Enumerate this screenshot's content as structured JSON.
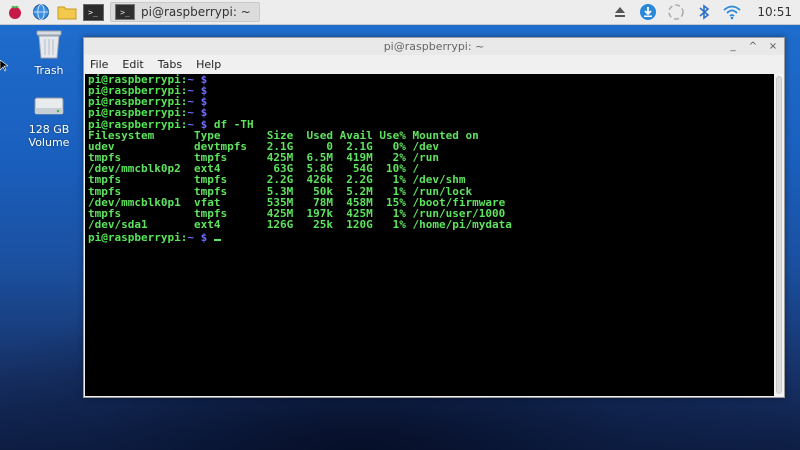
{
  "taskbar": {
    "window_button_label": "pi@raspberrypi: ~",
    "terminal_icon_text": ">_",
    "clock": "10:51"
  },
  "desktop": {
    "icons": [
      {
        "name": "trash-icon",
        "label": "Trash"
      },
      {
        "name": "drive-icon",
        "label": "128 GB\nVolume"
      }
    ]
  },
  "window": {
    "title": "pi@raspberrypi: ~",
    "menu": [
      "File",
      "Edit",
      "Tabs",
      "Help"
    ],
    "controls": [
      "_",
      "^",
      "×"
    ]
  },
  "terminal": {
    "prompt_user": "pi@raspberrypi:",
    "prompt_path": "~",
    "prompt_symbol": "$",
    "empty_prompts": 4,
    "command": "df -TH",
    "header": [
      "Filesystem",
      "Type",
      "Size",
      "Used",
      "Avail",
      "Use%",
      "Mounted on"
    ],
    "rows": [
      [
        "udev",
        "devtmpfs",
        "2.1G",
        "0",
        "2.1G",
        "0%",
        "/dev"
      ],
      [
        "tmpfs",
        "tmpfs",
        "425M",
        "6.5M",
        "419M",
        "2%",
        "/run"
      ],
      [
        "/dev/mmcblk0p2",
        "ext4",
        "63G",
        "5.8G",
        "54G",
        "10%",
        "/"
      ],
      [
        "tmpfs",
        "tmpfs",
        "2.2G",
        "426k",
        "2.2G",
        "1%",
        "/dev/shm"
      ],
      [
        "tmpfs",
        "tmpfs",
        "5.3M",
        "50k",
        "5.2M",
        "1%",
        "/run/lock"
      ],
      [
        "/dev/mmcblk0p1",
        "vfat",
        "535M",
        "78M",
        "458M",
        "15%",
        "/boot/firmware"
      ],
      [
        "tmpfs",
        "tmpfs",
        "425M",
        "197k",
        "425M",
        "1%",
        "/run/user/1000"
      ],
      [
        "/dev/sda1",
        "ext4",
        "126G",
        "25k",
        "120G",
        "1%",
        "/home/pi/mydata"
      ]
    ]
  },
  "colors": {
    "terminal_green": "#5ee35e",
    "prompt_blue": "#6c6cff",
    "terminal_bg": "#000000"
  }
}
